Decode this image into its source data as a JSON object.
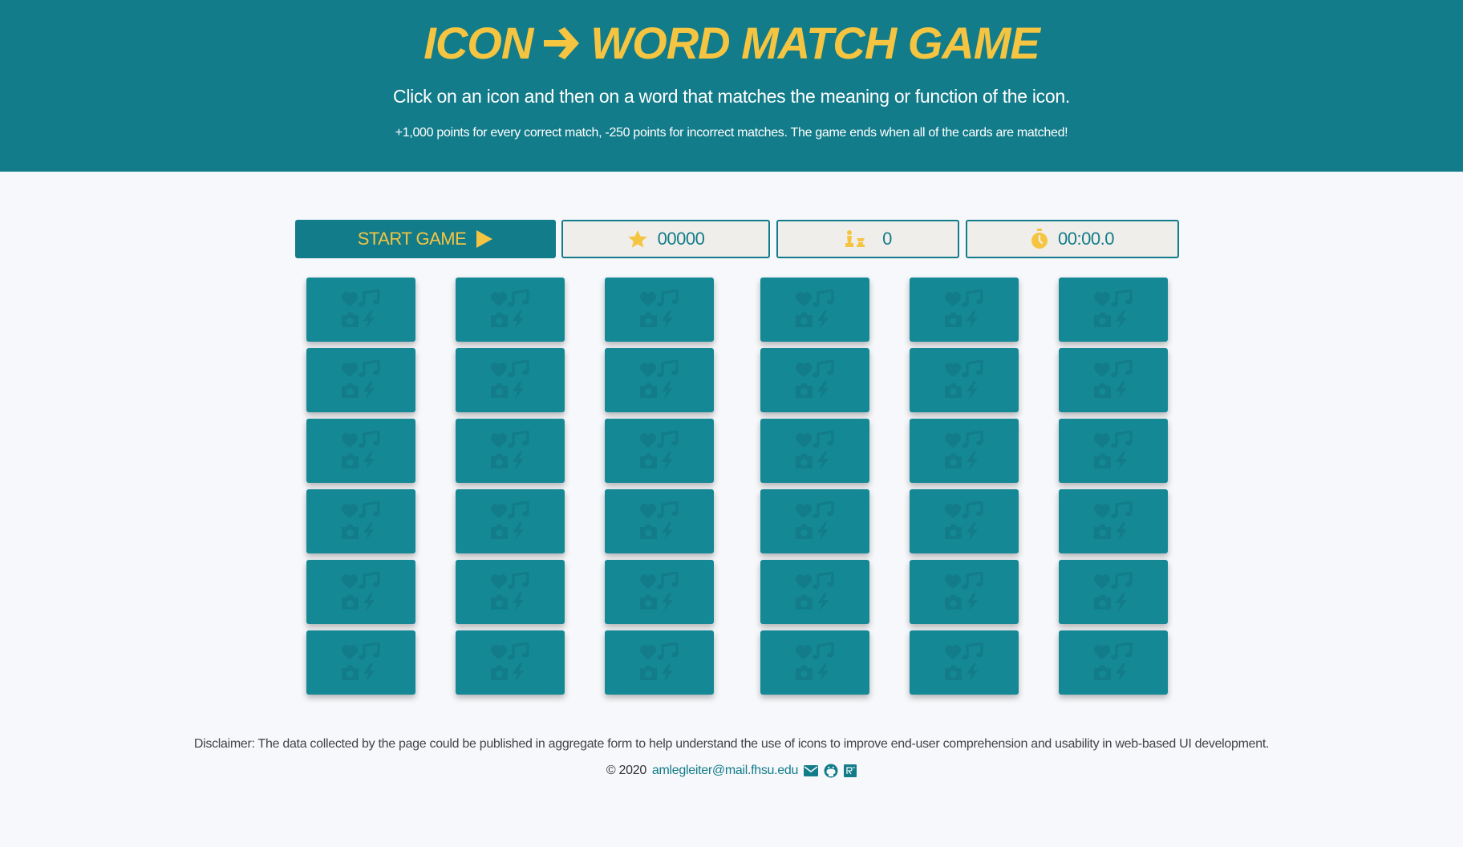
{
  "header": {
    "title_left": "Icon",
    "title_right": "Word Match Game",
    "arrow_icon": "arrow-right-icon",
    "subtitle": "Click on an icon and then on a word that matches the meaning or function of the icon.",
    "rules": "+1,000 points for every correct match, -250 points for incorrect matches. The game ends when all of the cards are matched!"
  },
  "controls": {
    "start_label": "START GAME",
    "start_icon": "play-icon",
    "score_value": "00000",
    "score_icon": "star-icon",
    "matches_value": "0",
    "matches_icon": "chess-pieces-icon",
    "timer_value": "00:00.0",
    "timer_icon": "stopwatch-icon"
  },
  "board": {
    "rows": 6,
    "columns": 6,
    "card_back_icon": "card-back-icons-heart-music-camera-bolt",
    "card_color": "#158896"
  },
  "footer": {
    "disclaimer": "Disclaimer: The data collected by the page could be published in aggregate form to help understand the use of icons to improve end-user comprehension and usability in web-based UI development.",
    "copyright": "© 2020",
    "email": "amlegleiter@mail.fhsu.edu",
    "icons": [
      "envelope-icon",
      "github-icon",
      "researchgate-icon"
    ]
  },
  "colors": {
    "header_bg": "#137c8a",
    "accent": "#f5c542",
    "page_bg": "#f6f8fb"
  }
}
